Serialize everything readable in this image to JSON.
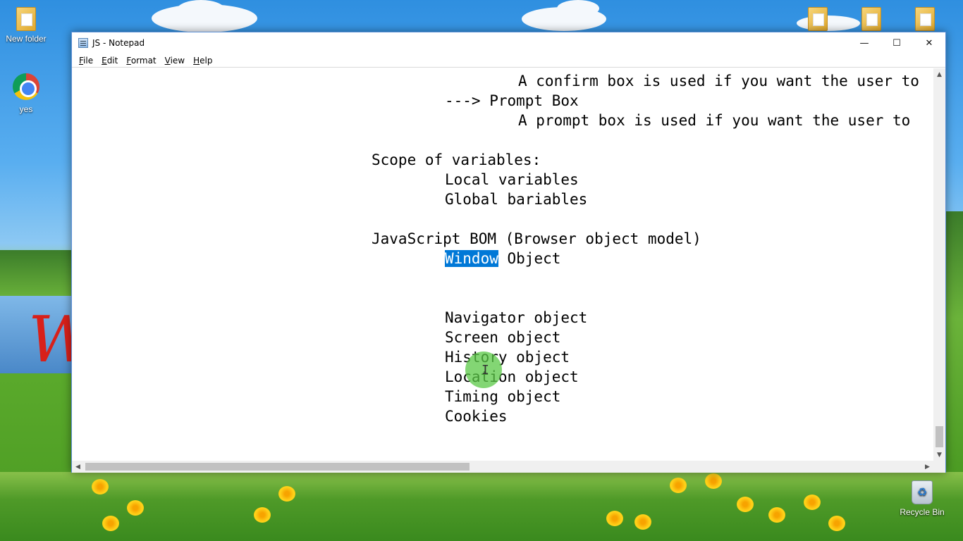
{
  "desktop": {
    "icons": [
      {
        "label": "New folder",
        "icon": "folder-icon"
      },
      {
        "label": "yes",
        "icon": "chrome-icon"
      },
      {
        "label": "Recycle Bin",
        "icon": "recycle-bin-icon"
      }
    ]
  },
  "window": {
    "title": "JS - Notepad",
    "controls": {
      "minimize": "—",
      "maximize": "☐",
      "close": "✕"
    }
  },
  "menu": [
    {
      "underline": "F",
      "rest": "ile"
    },
    {
      "underline": "E",
      "rest": "dit"
    },
    {
      "underline": "F",
      "rest": "ormat",
      "prefix": ""
    },
    {
      "underline": "V",
      "rest": "iew"
    },
    {
      "underline": "H",
      "rest": "elp"
    }
  ],
  "menu_labels": [
    "File",
    "Edit",
    "Format",
    "View",
    "Help"
  ],
  "editor": {
    "lines": [
      "A confirm box is used if you want the user to",
      "---> Prompt Box",
      "A prompt box is used if you want the user to",
      "Scope of variables:",
      "Local variables",
      "Global bariables",
      "JavaScript BOM (Browser object model)",
      "Object",
      "Navigator object",
      "Screen object",
      "History object",
      "Location object",
      "Timing object",
      "Cookies"
    ],
    "selected_text": "Window"
  },
  "scroll": {
    "up": "▲",
    "down": "▼",
    "left": "◀",
    "right": "▶"
  }
}
